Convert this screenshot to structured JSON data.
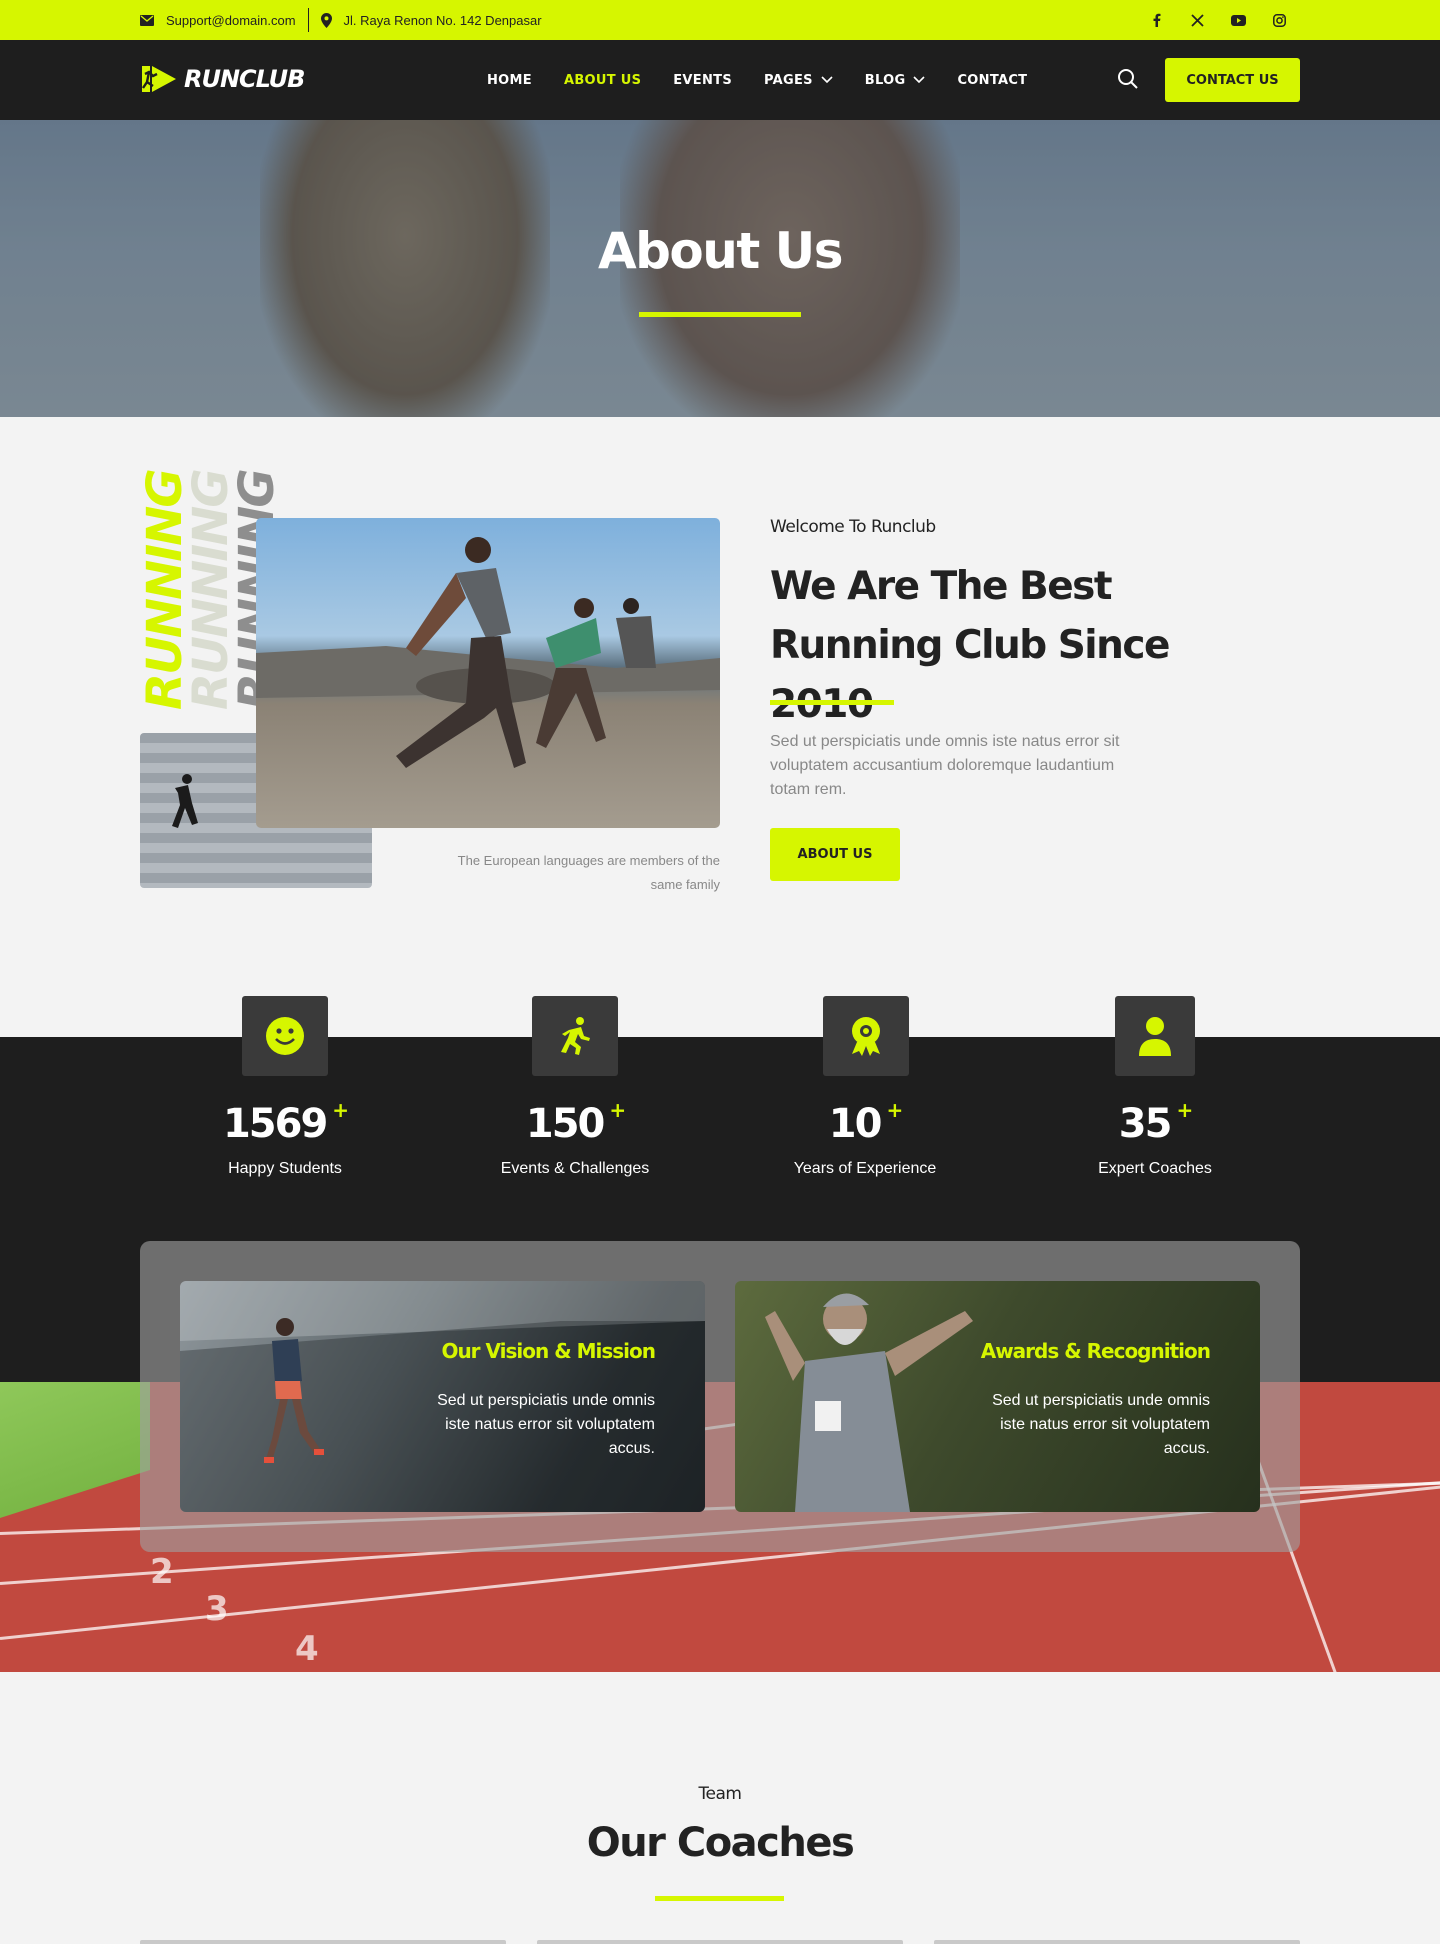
{
  "topbar": {
    "email": "Support@domain.com",
    "address": "Jl. Raya Renon No. 142 Denpasar",
    "socials": [
      "facebook-icon",
      "x-icon",
      "youtube-icon",
      "instagram-icon"
    ]
  },
  "nav": {
    "logo_text": "RUNCLUB",
    "items": [
      {
        "label": "HOME"
      },
      {
        "label": "ABOUT US",
        "active": true
      },
      {
        "label": "EVENTS"
      },
      {
        "label": "PAGES",
        "dropdown": true
      },
      {
        "label": "BLOG",
        "dropdown": true
      },
      {
        "label": "CONTACT"
      }
    ],
    "cta": "CONTACT US"
  },
  "hero": {
    "title": "About Us"
  },
  "about": {
    "vertical_word": "RUNNING",
    "caption": "The European languages are members of the same family",
    "eyebrow": "Welcome To Runclub",
    "heading": "We Are The Best Running Club Since 2010",
    "description": "Sed ut perspiciatis unde omnis iste natus error sit voluptatem accusantium doloremque laudantium totam rem.",
    "button": "ABOUT US"
  },
  "stats": [
    {
      "icon": "smiley-icon",
      "value": "1569",
      "suffix": "+",
      "label": "Happy Students"
    },
    {
      "icon": "runner-icon",
      "value": "150",
      "suffix": "+",
      "label": "Events & Challenges"
    },
    {
      "icon": "award-icon",
      "value": "10",
      "suffix": "+",
      "label": "Years of Experience"
    },
    {
      "icon": "person-icon",
      "value": "35",
      "suffix": "+",
      "label": "Expert Coaches"
    }
  ],
  "cards": [
    {
      "title": "Our Vision & Mission",
      "text": "Sed ut perspiciatis unde omnis iste natus error sit voluptatem accus."
    },
    {
      "title": "Awards & Recognition",
      "text": "Sed ut perspiciatis unde omnis iste natus error sit voluptatem accus."
    }
  ],
  "team": {
    "eyebrow": "Team",
    "heading": "Our Coaches"
  },
  "colors": {
    "accent": "#d6f600",
    "dark": "#1e1e1e",
    "track": "#c1493f"
  }
}
